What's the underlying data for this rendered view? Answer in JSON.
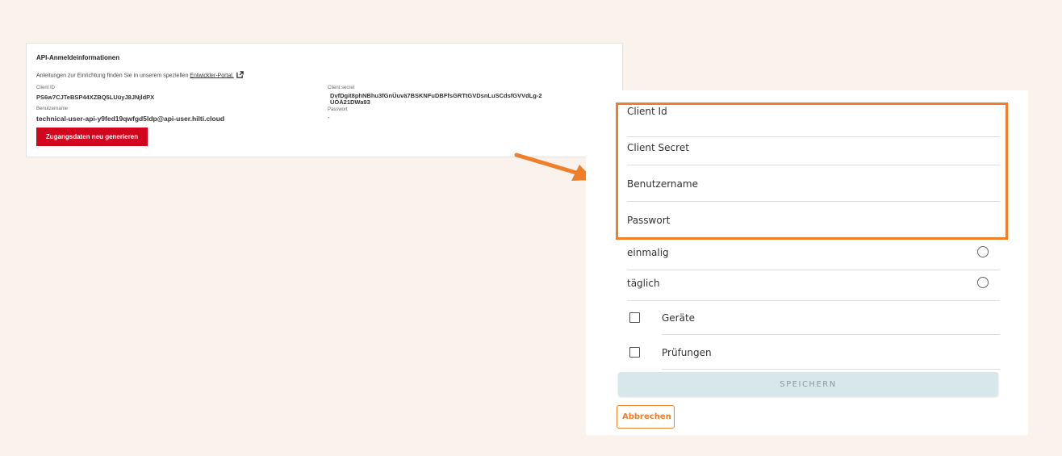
{
  "api_card": {
    "title": "API-Anmeldeinformationen",
    "hint_text": "Anleitungen zur Einrichtung finden Sie in unserem speziellen ",
    "hint_link": "Entwickler-Portal.",
    "client_id_label": "Client ID",
    "client_id_value": "PS6w7CJTeBSP44XZBQ5LUüyJ8JNjldPX",
    "username_label": "Benutzername",
    "username_value": "technical-user-api-y9fed19qwfgd5ldp@api-user.hilti.cloud",
    "client_secret_label": "Client secret",
    "client_secret_line1": "DvfDgit8phNBhu3fGnÜuvä7BSKNFuDBFfsGRTtGVDsnLuSCdsfGVVdLg-2",
    "client_secret_line2": "ÜÖÄ21DWa93",
    "password_label": "Passwort",
    "password_value": "-",
    "regenerate_button": "Zugangsdaten neu generieren"
  },
  "form": {
    "fields": [
      "Client Id",
      "Client Secret",
      "Benutzername",
      "Passwort"
    ],
    "frequency_options": [
      "einmalig",
      "täglich"
    ],
    "checkbox_options": [
      "Geräte",
      "Prüfungen"
    ],
    "save_button": "SPEICHERN",
    "cancel_button": "Abbrechen"
  },
  "colors": {
    "accent_orange": "#f07f2a",
    "brand_red": "#d2051e",
    "page_background": "#faf2ec",
    "save_button_bg": "#d8e8ea"
  }
}
